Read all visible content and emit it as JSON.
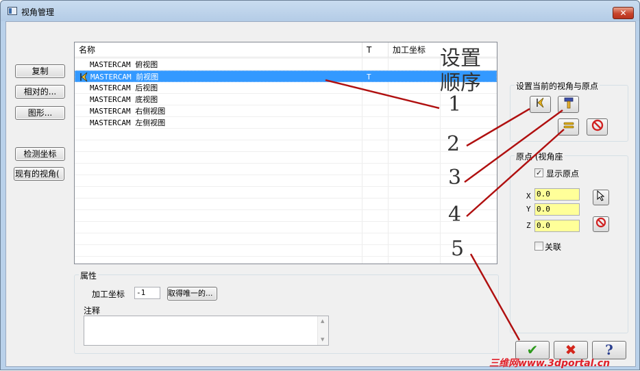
{
  "window": {
    "title": "视角管理",
    "close_glyph": "✕"
  },
  "left_buttons": {
    "copy": "复制",
    "relative": "相对的...",
    "graphics": "图形...",
    "detect_coords": "检测坐标",
    "existing_views": "现有的视角("
  },
  "list": {
    "columns": [
      "名称",
      "T",
      "加工坐标"
    ],
    "rows": [
      {
        "name": "MASTERCAM 俯视图",
        "t": "",
        "selected": false
      },
      {
        "name": "MASTERCAM 前视图",
        "t": "T",
        "selected": true
      },
      {
        "name": "MASTERCAM 后视图",
        "t": "",
        "selected": false
      },
      {
        "name": "MASTERCAM 底视图",
        "t": "",
        "selected": false
      },
      {
        "name": "MASTERCAM 右侧视图",
        "t": "",
        "selected": false
      },
      {
        "name": "MASTERCAM 左侧视图",
        "t": "",
        "selected": false
      }
    ]
  },
  "properties": {
    "group_label": "属性",
    "work_coord_label": "加工坐标",
    "work_coord_value": "-1",
    "get_unique_button": "取得唯一的...",
    "notes_label": "注释",
    "scroll_up": "▲",
    "scroll_down": "▼"
  },
  "set_view_group": {
    "label": "设置当前的视角与原点"
  },
  "origin_group": {
    "label": "原点 (视角座",
    "show_origin_label": "显示原点",
    "show_origin_checked": true,
    "checkmark": "✓",
    "x_label": "X",
    "x_value": "0.0",
    "y_label": "Y",
    "y_value": "0.0",
    "z_label": "Z",
    "z_value": "0.0",
    "link_label": "关联",
    "link_checked": false
  },
  "dialog_buttons": {
    "ok": "✔",
    "cancel": "✖",
    "help": "?"
  },
  "annotations": {
    "title_line1": "设置",
    "title_line2": "顺序",
    "n1": "1",
    "n2": "2",
    "n3": "3",
    "n4": "4",
    "n5": "5",
    "watermark": "三维网www.3dportal.cn"
  },
  "colors": {
    "selection": "#3399ff",
    "input_bg": "#ffff99",
    "annotation_line": "#b01010",
    "ok_green": "#2d9a1c",
    "cancel_red": "#d3261c",
    "help_navy": "#2a3f8f"
  }
}
